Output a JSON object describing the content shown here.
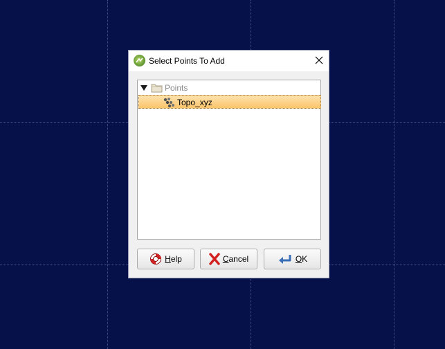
{
  "background": {
    "color": "#061149",
    "grid_color": "#4a568f"
  },
  "dialog": {
    "title": "Select Points To Add",
    "icons": {
      "app": "app-logo-icon",
      "close": "close-icon"
    }
  },
  "tree": {
    "root": {
      "label": "Points",
      "expanded": true,
      "icon": "folder-icon",
      "expander_icon": "triangle-down-icon"
    },
    "children": [
      {
        "label": "Topo_xyz",
        "selected": true,
        "icon": "point-set-icon",
        "highlight_color": "#fbc46b"
      }
    ]
  },
  "buttons": {
    "help": {
      "label": "Help",
      "icon": "lifebuoy-icon"
    },
    "cancel": {
      "label": "Cancel",
      "icon": "red-x-icon"
    },
    "ok": {
      "label": "OK",
      "icon": "return-arrow-icon"
    }
  }
}
